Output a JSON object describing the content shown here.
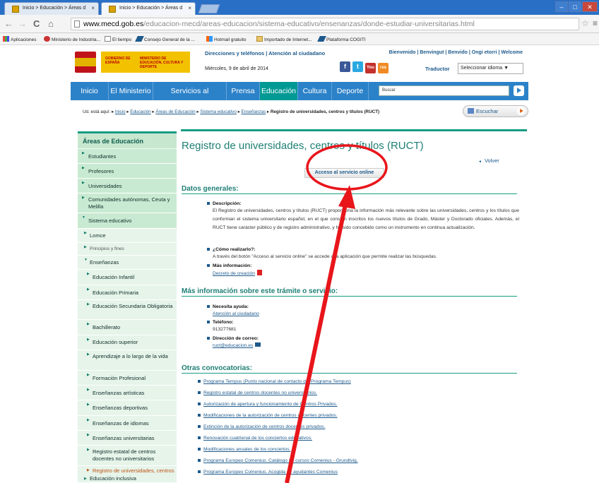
{
  "browser": {
    "tabs": [
      {
        "label": "Inicio > Educación > Áreas d"
      },
      {
        "label": "Inicio > Educación > Áreas d"
      }
    ],
    "tab_close": "×",
    "url_host": "www.mecd.gob.es",
    "url_path": "/educacion-mecd/areas-educacion/sistema-educativo/ensenanzas/donde-estudiar-universitarias.html",
    "nav": {
      "back": "←",
      "forward": "→",
      "reload": "C",
      "home": "⌂"
    },
    "star": "☆",
    "menu": "≡",
    "window": {
      "minimize": "–",
      "maximize": "□",
      "close": "✕"
    },
    "bookmarks": [
      "Aplicaciones",
      "Ministerio de Industria...",
      "El tiempo",
      "Consejo General de la ...",
      "Hotmail gratuito",
      "Importado de Internet...",
      "Plataforma COGITI"
    ]
  },
  "header": {
    "logo_gov": "GOBIERNO DE ESPAÑA",
    "logo_min": "MINISTERIO DE EDUCACIÓN, CULTURA Y DEPORTE",
    "top_links": "Direcciones y teléfonos | Atención al ciudadano",
    "welcome": "Bienvenido | Benvingut | Benvido | Ongi etorri | Welcome",
    "date": "Miércoles, 9 de abril de 2014",
    "translator_label": "Traductor",
    "language_select": "Seleccionar idioma ▼",
    "social": [
      "f",
      "t",
      "You",
      "rss"
    ]
  },
  "mainnav": {
    "items": [
      "Inicio",
      "El Ministerio",
      "Servicios al ciudadano",
      "Prensa",
      "Educación",
      "Cultura",
      "Deporte"
    ],
    "search_placeholder": "Buscar"
  },
  "breadcrumb": {
    "prefix": "Ud. está aquí:",
    "links": [
      "Inicio",
      "Educación",
      "Áreas de Educación",
      "Sistema educativo",
      "Enseñanzas"
    ],
    "current": "Registro de universidades, centros y títulos (RUCT)"
  },
  "listen_label": "Escuchar",
  "sidebar": {
    "title": "Áreas de Educación",
    "items": [
      "Estudiantes",
      "Profesores",
      "Universidades",
      "Comunidades autónomas, Ceuta y Melilla",
      "Sistema educativo",
      "Lomce",
      "Principios y fines",
      "Enseñanzas",
      "Educación Infantil",
      "Educación Primaria",
      "Educación Secundaria Obligatoria",
      "Bachillerato",
      "Educación superior",
      "Aprendizaje a lo largo de la vida",
      "Formación Profesional",
      "Enseñanzas artísticas",
      "Enseñanzas deportivas",
      "Enseñanzas de idiomas",
      "Enseñanzas universitarias",
      "Registro estatal de centros docentes no universitarios",
      "Registro de universidades, centros y títulos (RUCT)",
      "Educación inclusiva"
    ]
  },
  "main": {
    "title": "Registro de universidades, centros y títulos (RUCT)",
    "back_link": "Volver",
    "access_button": "Acceso al servicio online",
    "general": {
      "heading": "Datos generales:",
      "desc_label": "Descripción:",
      "desc_text": "El Registro de universidades, centros y títulos (RUCT) proporciona la información más relevante sobre las universidades, centros y los títulos que conforman el sistema universitario español, en el que constan inscritos los nuevos títulos de Grado, Máster y Doctorado oficiales. Además, el RUCT tiene carácter público y de registro administrativo, y ha sido concebido como un instrumento en continua actualización.",
      "how_label": "¿Cómo realizarlo?:",
      "how_text": "A través del botón \"Acceso al servicio online\" se accede a la aplicación que permite realizar las búsquedas.",
      "more_label": "Más información:",
      "more_link": "Decreto de creación"
    },
    "more_info": {
      "heading": "Más información sobre este trámite o servicio:",
      "help_label": "Necesita ayuda:",
      "help_link": "Atención al ciudadano",
      "phone_label": "Teléfono:",
      "phone": "913277681",
      "email_label": "Dirección de correo:",
      "email": "ruct@educacion.es"
    },
    "other": {
      "heading": "Otras convocatorias:",
      "items": [
        "Programa Tempus (Punto nacional de contacto del Programa Tempus)",
        "Registro estatal de centros docentes no universitarios.",
        "Autorización de apertura y funcionamiento de Centros Privados.",
        "Modificaciones de la autorización de centros docentes privados.",
        "Extinción de la autorización de centros docentes privados.",
        "Renovación cuatrienal de los conciertos educativos.",
        "Modificaciones anuales de los conciertos.",
        "Programa Europeo Comenius. Catálogo de cursos Comenius - Grundtvig.",
        "Programa Europeo Comenius. Acogida de ayudantes Comenius"
      ]
    }
  },
  "colors": {
    "accent_teal": "#179c83",
    "nav_blue": "#2c82c9",
    "nav_active": "#009994",
    "annotation_red": "#e8151b"
  }
}
